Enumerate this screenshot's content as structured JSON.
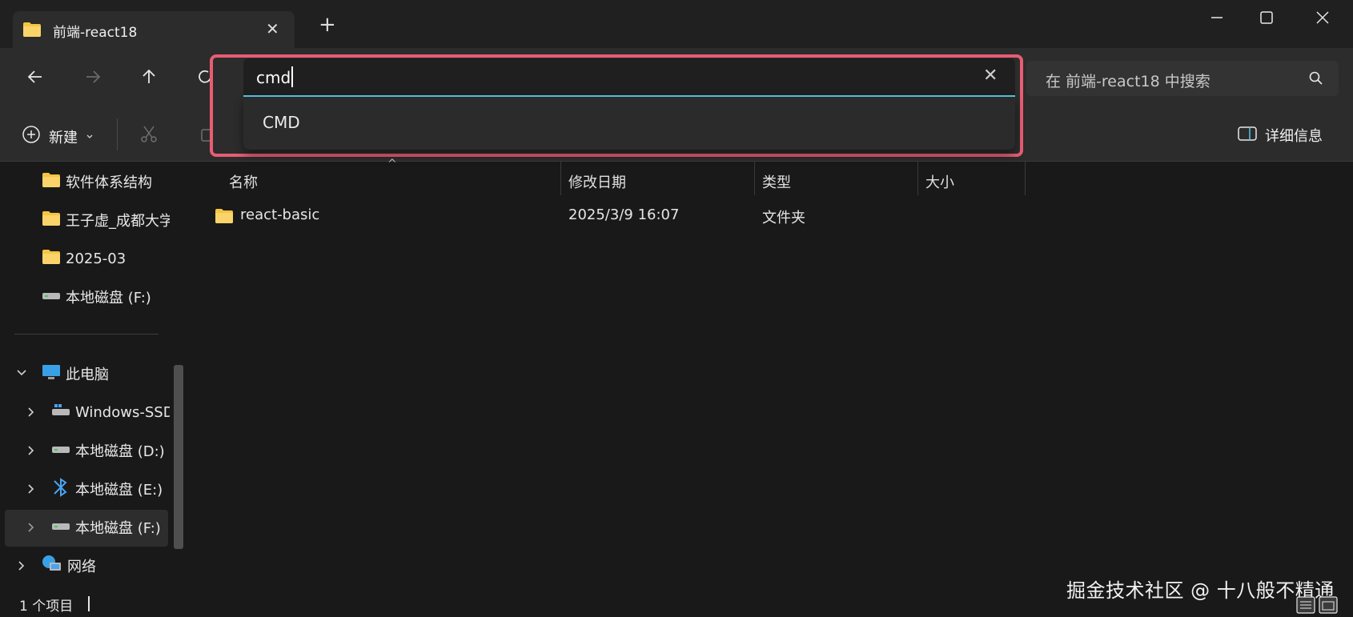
{
  "tab": {
    "title": "前端-react18",
    "folder_icon": "folder-icon",
    "close_icon": "close-icon"
  },
  "new_tab_label": "+",
  "window_controls": {
    "minimize": "minimize-icon",
    "maximize": "maximize-icon",
    "close": "close-icon"
  },
  "navigation": {
    "back": "arrow-left-icon",
    "forward": "arrow-right-icon",
    "up": "arrow-up-icon",
    "refresh": "refresh-icon"
  },
  "address_bar": {
    "value": "cmd",
    "clear_icon": "close-icon",
    "suggestions": [
      "CMD"
    ],
    "highlight_color": "#e85d73",
    "focus_color": "#57c7e6"
  },
  "search": {
    "placeholder": "在 前端-react18 中搜索",
    "icon": "search-icon"
  },
  "toolbar": {
    "new_label": "新建",
    "details_label": "详细信息"
  },
  "sidebar": {
    "quick_items": [
      {
        "label": "软件体系结构",
        "icon": "folder-icon"
      },
      {
        "label": "王子虚_成都大学",
        "icon": "folder-icon"
      },
      {
        "label": "2025-03",
        "icon": "folder-icon"
      },
      {
        "label": "本地磁盘 (F:)",
        "icon": "drive-icon"
      }
    ],
    "this_pc": {
      "label": "此电脑",
      "icon": "computer-icon"
    },
    "drives": [
      {
        "label": "Windows-SSD",
        "icon": "windows-drive-icon"
      },
      {
        "label": "本地磁盘 (D:)",
        "icon": "drive-icon"
      },
      {
        "label": "本地磁盘 (E:)",
        "icon": "bluetooth-drive-icon"
      },
      {
        "label": "本地磁盘 (F:)",
        "icon": "drive-icon"
      }
    ],
    "network": {
      "label": "网络",
      "icon": "network-icon"
    }
  },
  "columns": [
    "名称",
    "修改日期",
    "类型",
    "大小"
  ],
  "rows": [
    {
      "name": "react-basic",
      "modified": "2025/3/9 16:07",
      "type": "文件夹",
      "size": ""
    }
  ],
  "status": {
    "count": "1 个项目"
  },
  "watermark": "掘金技术社区 @ 十八般不精通"
}
